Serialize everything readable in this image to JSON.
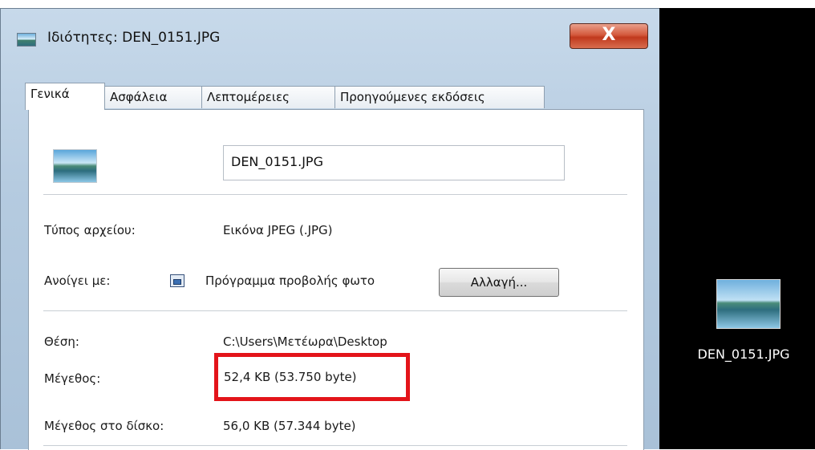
{
  "window": {
    "title": "Ιδιότητες: DEN_0151.JPG",
    "close_label": "X"
  },
  "tabs": [
    {
      "label": "Γενικά",
      "active": true
    },
    {
      "label": "Ασφάλεια",
      "active": false
    },
    {
      "label": "Λεπτομέρειες",
      "active": false
    },
    {
      "label": "Προηγούμενες εκδόσεις",
      "active": false
    }
  ],
  "general": {
    "filename": "DEN_0151.JPG",
    "file_type_label": "Τύπος αρχείου:",
    "file_type_value": "Εικόνα JPEG (.JPG)",
    "opens_with_label": "Ανοίγει με:",
    "opens_with_value": "Πρόγραμμα προβολής φωτο",
    "change_button": "Αλλαγή...",
    "location_label": "Θέση:",
    "location_value": "C:\\Users\\Μετέωρα\\Desktop",
    "size_label": "Μέγεθος:",
    "size_value": "52,4 KB (53.750 byte)",
    "size_on_disk_label": "Μέγεθος στο δίσκο:",
    "size_on_disk_value": "56,0 KB (57.344 byte)"
  },
  "desktop": {
    "icon_label": "DEN_0151.JPG"
  },
  "colors": {
    "highlight": "#e3141a",
    "desktop_bg": "#000000",
    "close_button": "#c0391d"
  }
}
